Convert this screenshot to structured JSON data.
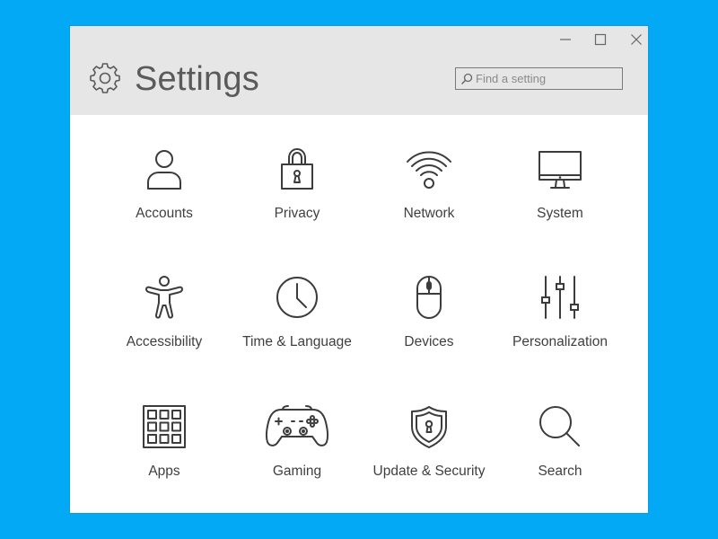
{
  "window": {
    "title": "Settings",
    "controls": [
      "minimize-icon",
      "maximize-icon",
      "close-icon"
    ]
  },
  "search": {
    "placeholder": "Find a setting",
    "value": ""
  },
  "colors": {
    "background": "#03a9f4",
    "header": "#e6e6e6",
    "icon": "#3c3c3c"
  },
  "tiles": [
    {
      "label": "Accounts",
      "icon": "person-icon"
    },
    {
      "label": "Privacy",
      "icon": "padlock-icon"
    },
    {
      "label": "Network",
      "icon": "wifi-icon"
    },
    {
      "label": "System",
      "icon": "monitor-icon"
    },
    {
      "label": "Accessibility",
      "icon": "accessibility-person-icon"
    },
    {
      "label": "Time & Language",
      "icon": "clock-icon"
    },
    {
      "label": "Devices",
      "icon": "mouse-icon"
    },
    {
      "label": "Personalization",
      "icon": "sliders-icon"
    },
    {
      "label": "Apps",
      "icon": "app-grid-icon"
    },
    {
      "label": "Gaming",
      "icon": "gamepad-icon"
    },
    {
      "label": "Update & Security",
      "icon": "shield-icon"
    },
    {
      "label": "Search",
      "icon": "magnifier-icon"
    }
  ]
}
